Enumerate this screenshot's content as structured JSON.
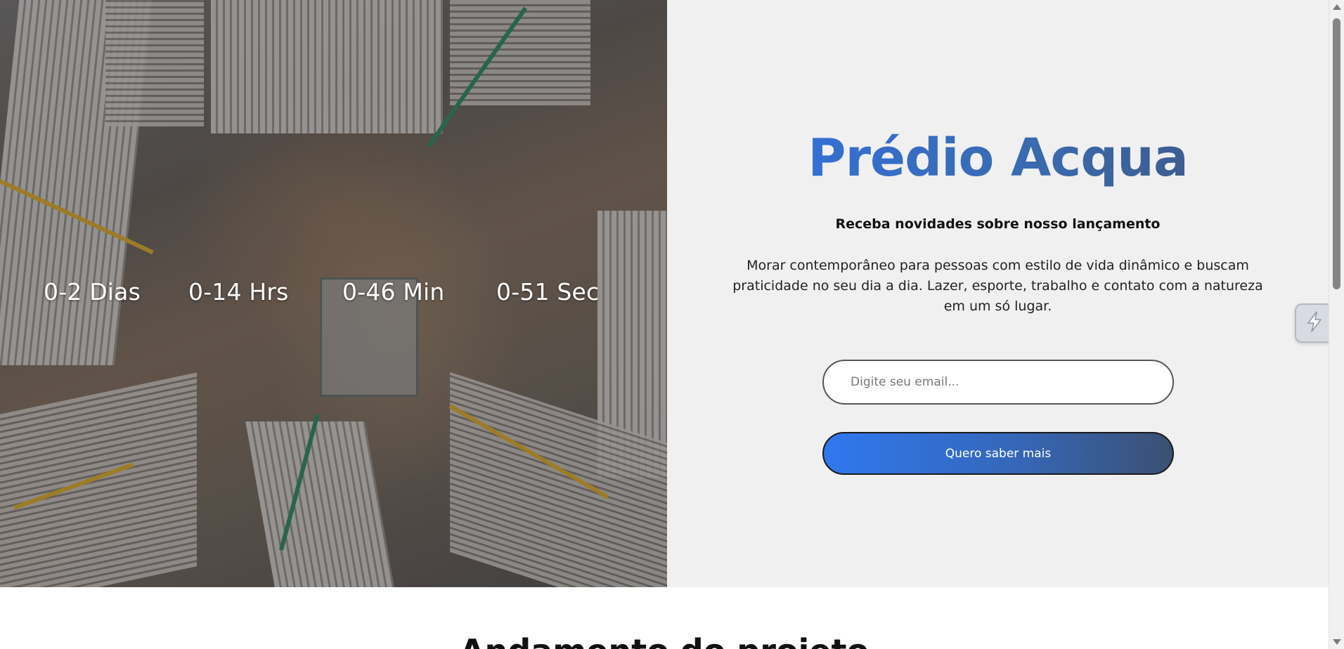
{
  "hero": {
    "countdown": {
      "days": "0-2 Dias",
      "hours": "0-14 Hrs",
      "minutes": "0-46 Min",
      "seconds": "0-51 Sec"
    },
    "title": "Prédio Acqua",
    "subtitle": "Receba novidades sobre nosso lançamento",
    "description": "Morar contemporâneo para pessoas com estilo de vida dinâmico e buscam praticidade no seu dia a dia. Lazer, esporte, trabalho e contato com a natureza em um só lugar.",
    "email_placeholder": "Digite seu email...",
    "cta_label": "Quero saber mais"
  },
  "next_section": {
    "title": "Andamento do projeto"
  },
  "colors": {
    "gradient_start": "#2f78ef",
    "gradient_end": "#3b5073",
    "content_background": "#f0f0f0"
  },
  "icons": {
    "widget": "lightning-icon"
  }
}
